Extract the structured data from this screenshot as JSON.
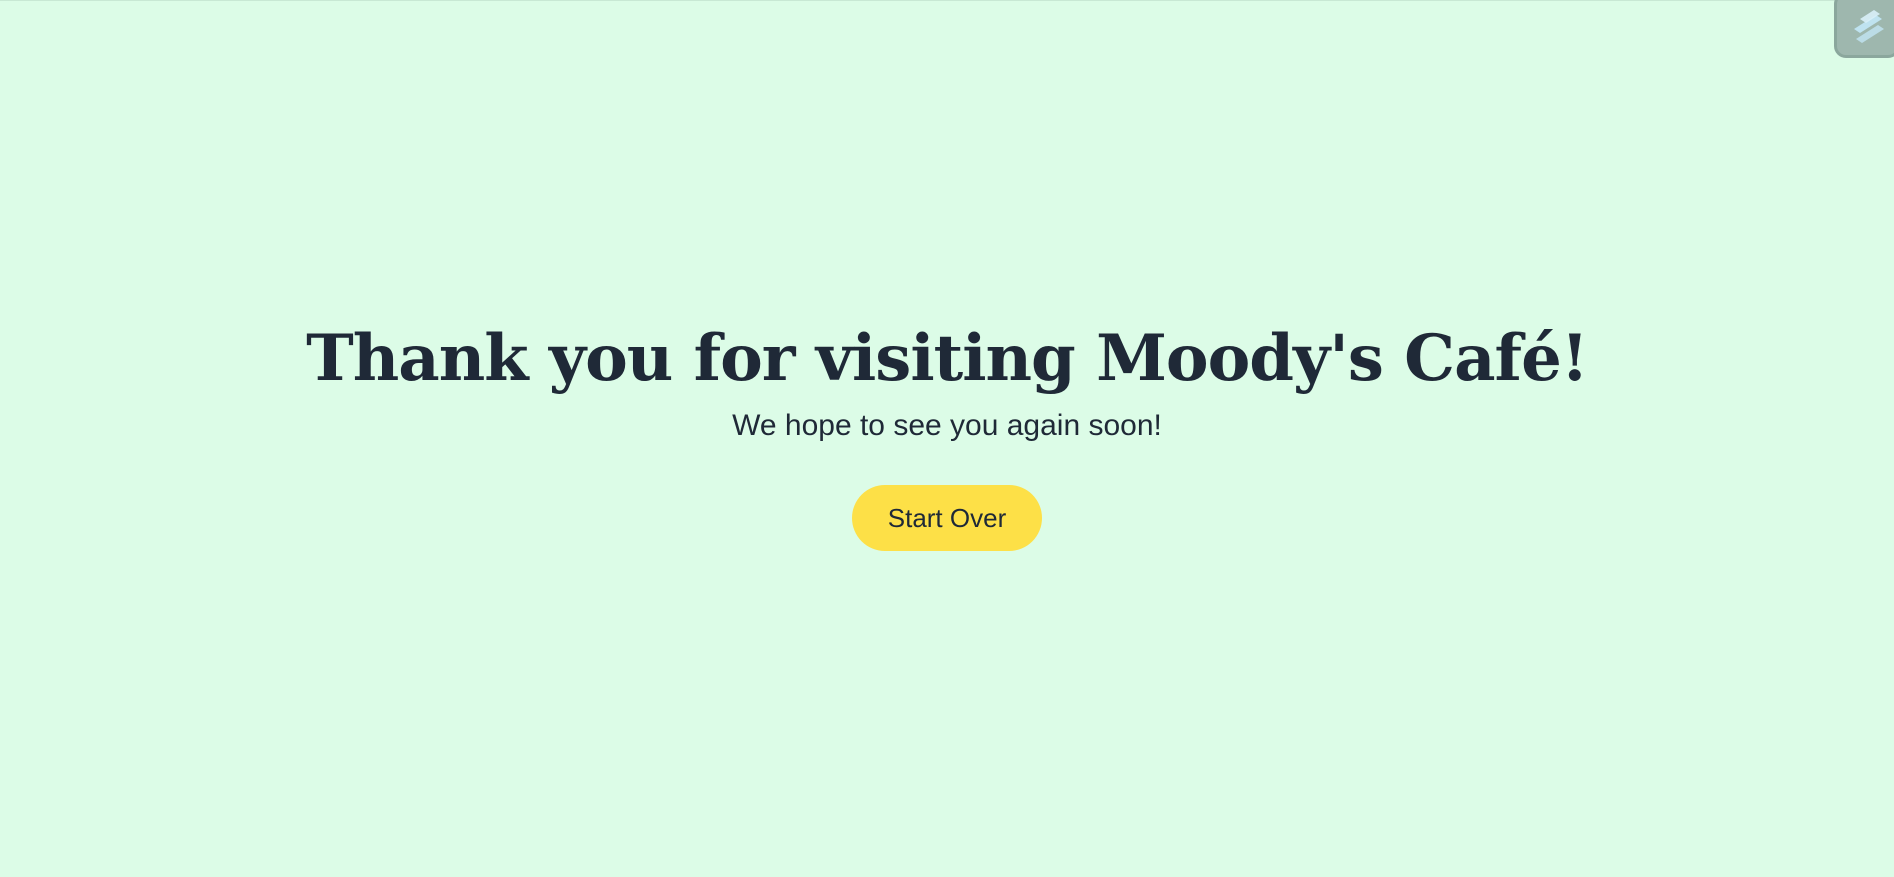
{
  "page": {
    "headline": "Thank you for visiting Moody's Café!",
    "subline": "We hope to see you again soon!",
    "start_over_label": "Start Over"
  },
  "widget": {
    "icon": "stack-layers-icon"
  },
  "colors": {
    "background": "#dcfce7",
    "text": "#1f2937",
    "button": "#fde047",
    "widget": "#9eb7ae",
    "widget_icon": "#bfe3f0"
  }
}
